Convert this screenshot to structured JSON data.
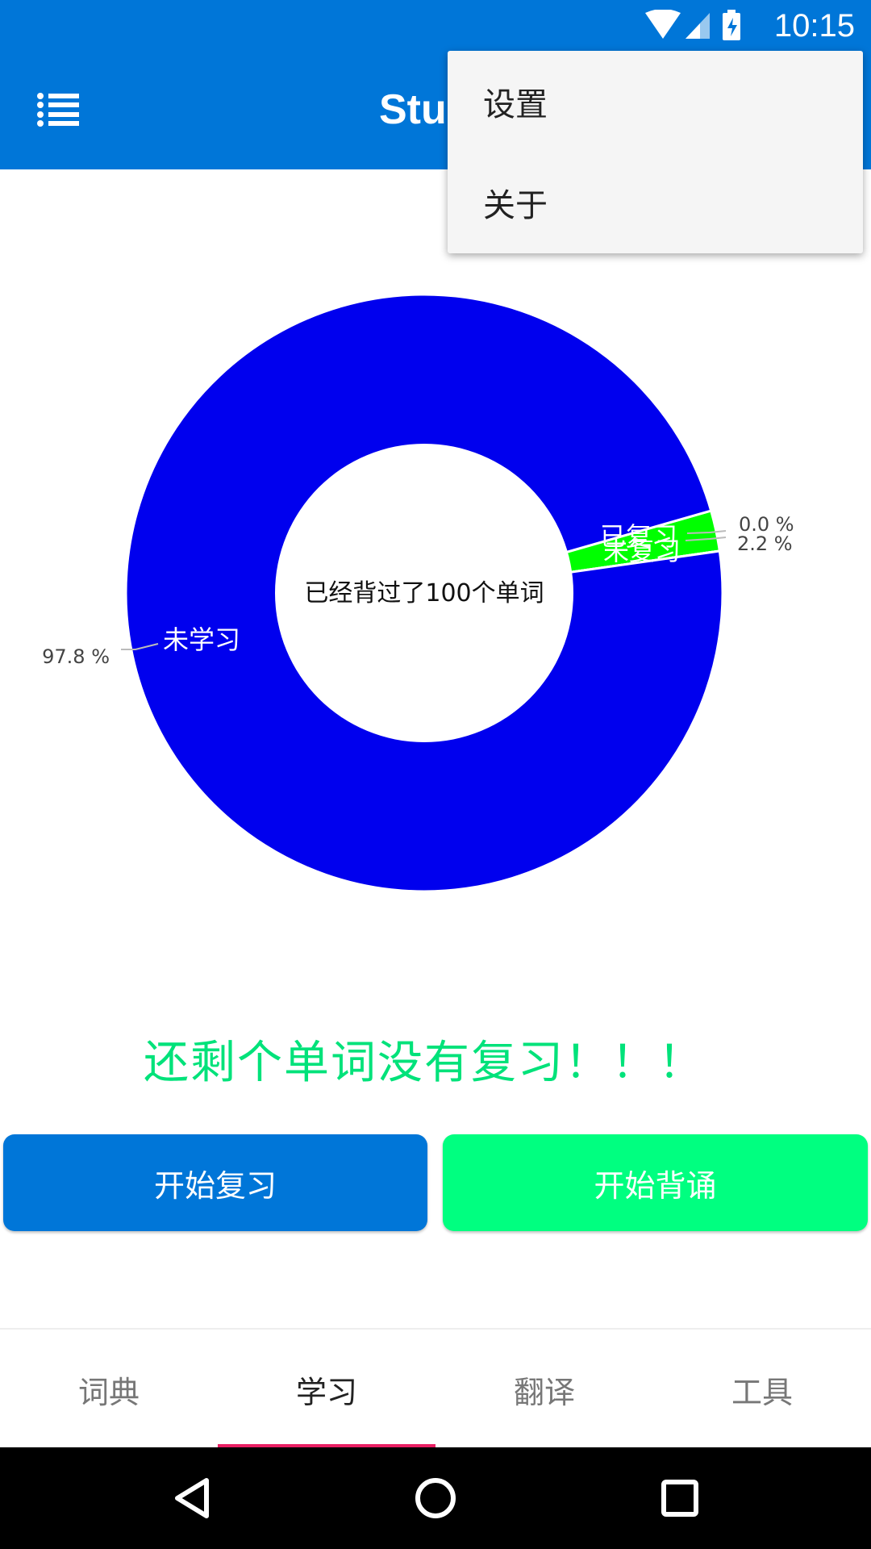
{
  "status_bar": {
    "time": "10:15"
  },
  "app_bar": {
    "title": "Stud"
  },
  "overflow_menu": {
    "items": [
      "设置",
      "关于"
    ]
  },
  "chart_data": {
    "type": "pie",
    "donut": true,
    "center_text": "已经背过了100个单词",
    "slices": [
      {
        "label": "未学习",
        "value": 97.8,
        "percent_label": "97.8 %",
        "color": "#0000ee"
      },
      {
        "label": "未复习",
        "value": 2.2,
        "percent_label": "2.2 %",
        "color": "#00ff00"
      },
      {
        "label": "已复习",
        "value": 0.0,
        "percent_label": "0.0 %",
        "color": "#00ff00"
      }
    ]
  },
  "remain_message": "还剩个单词没有复习！！！",
  "buttons": {
    "review": "开始复习",
    "memorize": "开始背诵"
  },
  "colors": {
    "primary": "#0076d8",
    "accent_green": "#00ff80",
    "tab_indicator": "#e91e63"
  },
  "tabs": [
    {
      "label": "词典",
      "active": false
    },
    {
      "label": "学习",
      "active": true
    },
    {
      "label": "翻译",
      "active": false
    },
    {
      "label": "工具",
      "active": false
    }
  ]
}
